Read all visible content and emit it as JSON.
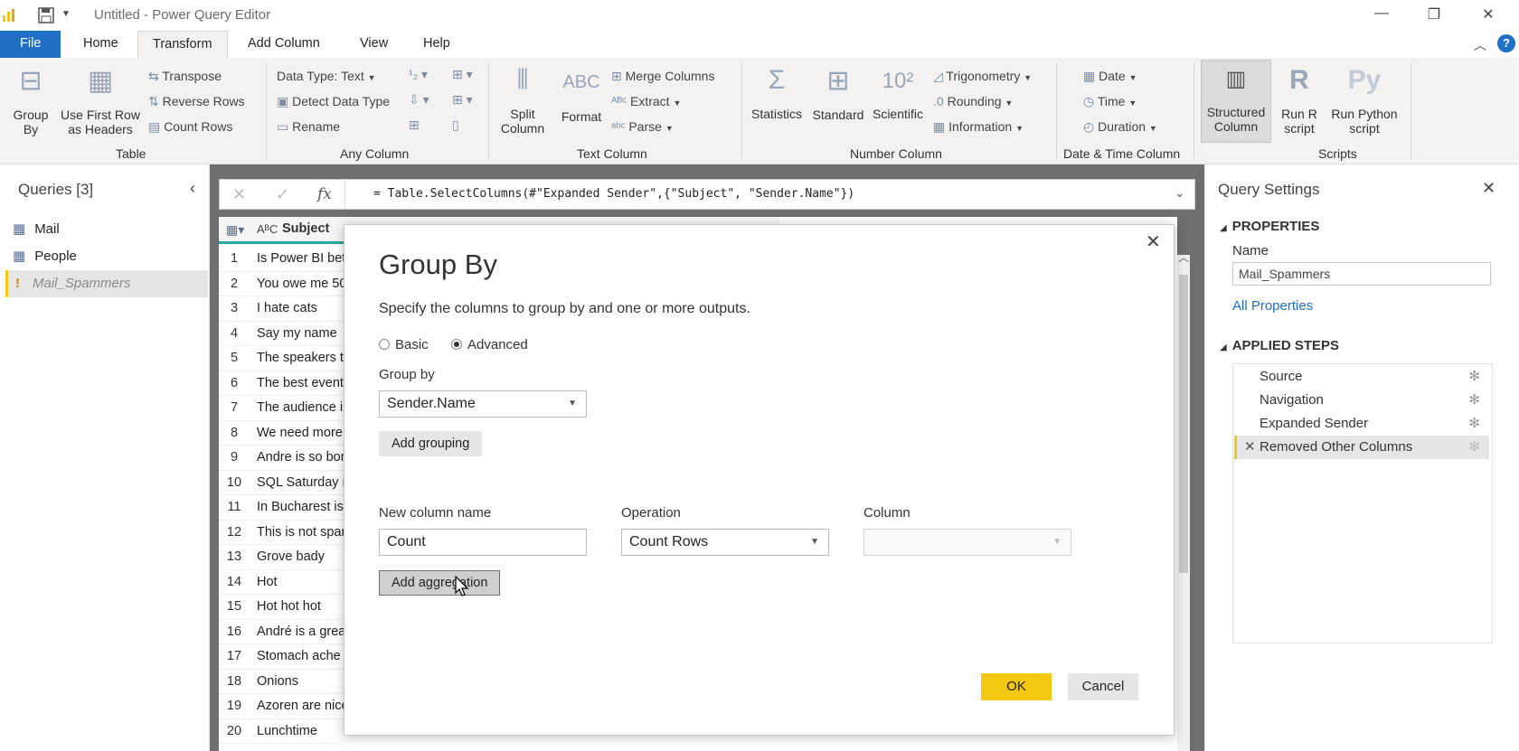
{
  "window": {
    "title": "Untitled - Power Query Editor"
  },
  "tabs": [
    "File",
    "Home",
    "Transform",
    "Add Column",
    "View",
    "Help"
  ],
  "ribbon": {
    "table": {
      "group_by": [
        "Group",
        "By"
      ],
      "first_row": [
        "Use First Row",
        "as Headers"
      ],
      "transpose": "Transpose",
      "reverse_rows": "Reverse Rows",
      "count_rows": "Count Rows",
      "group_label": "Table"
    },
    "any_column": {
      "data_type": "Data Type: Text",
      "detect": "Detect Data Type",
      "rename": "Rename",
      "group_label": "Any Column"
    },
    "text_column": {
      "split": [
        "Split",
        "Column"
      ],
      "format": "Format",
      "merge": "Merge Columns",
      "extract": "Extract",
      "parse": "Parse",
      "group_label": "Text Column"
    },
    "number_column": {
      "statistics": "Statistics",
      "standard": "Standard",
      "scientific": "Scientific",
      "trigonometry": "Trigonometry",
      "rounding": "Rounding",
      "information": "Information",
      "group_label": "Number Column"
    },
    "datetime_column": {
      "date": "Date",
      "time": "Time",
      "duration": "Duration",
      "group_label": "Date & Time Column"
    },
    "structured": [
      "Structured",
      "Column"
    ],
    "scripts": {
      "run_r": [
        "Run R",
        "script"
      ],
      "run_python": [
        "Run Python",
        "script"
      ],
      "group_label": "Scripts"
    }
  },
  "queries": {
    "title": "Queries [3]",
    "items": [
      "Mail",
      "People",
      "Mail_Spammers"
    ]
  },
  "formula": "= Table.SelectColumns(#\"Expanded Sender\",{\"Subject\", \"Sender.Name\"})",
  "grid": {
    "column_header": "Subject",
    "rows": [
      "Is Power BI bet",
      "You owe me 50",
      "I hate cats",
      "Say my name",
      "The speakers th",
      "The best event",
      "The audience is",
      "We need more",
      "Andre is so bor",
      "SQL Saturday r",
      "In Bucharest is",
      "This is not span",
      "Grove bady",
      "Hot",
      "Hot hot hot",
      "André is a grea",
      "Stomach ache",
      "Onions",
      "Azoren are nice",
      "Lunchtime"
    ],
    "row_numbers": [
      "1",
      "2",
      "3",
      "4",
      "5",
      "6",
      "7",
      "8",
      "9",
      "10",
      "11",
      "12",
      "13",
      "14",
      "15",
      "16",
      "17",
      "18",
      "19",
      "20"
    ]
  },
  "settings": {
    "title": "Query Settings",
    "properties": "PROPERTIES",
    "name_label": "Name",
    "name_value": "Mail_Spammers",
    "all_properties": "All Properties",
    "applied_steps": "APPLIED STEPS",
    "steps": [
      "Source",
      "Navigation",
      "Expanded Sender",
      "Removed Other Columns"
    ]
  },
  "dialog": {
    "title": "Group By",
    "description": "Specify the columns to group by and one or more outputs.",
    "basic": "Basic",
    "advanced": "Advanced",
    "group_by_label": "Group by",
    "group_by_value": "Sender.Name",
    "add_grouping": "Add grouping",
    "new_col_label": "New column name",
    "operation_label": "Operation",
    "column_label": "Column",
    "new_col_value": "Count",
    "operation_value": "Count Rows",
    "column_value": "",
    "add_aggregation": "Add aggregation",
    "ok": "OK",
    "cancel": "Cancel"
  },
  "colors": {
    "accent": "#f2c811",
    "file_tab": "#1f6fc5",
    "link": "#1f6fc5"
  }
}
